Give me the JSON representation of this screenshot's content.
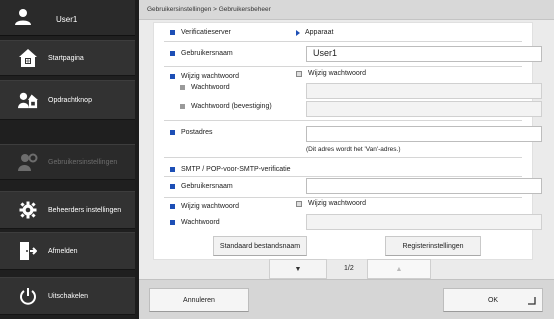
{
  "sidebar": {
    "user_label": "User1",
    "items": [
      {
        "label": "Startpagina"
      },
      {
        "label": "Opdrachtknop"
      },
      {
        "label": "Gebruikersinstellingen"
      },
      {
        "label": "Beheerders instellingen"
      },
      {
        "label": "Afmelden"
      },
      {
        "label": "Uitschakelen"
      }
    ]
  },
  "breadcrumb": "Gebruikersinstellingen > Gebruikersbeheer",
  "form": {
    "verification_server_label": "Verificatieserver",
    "verification_server_value": "Apparaat",
    "username_label": "Gebruikersnaam",
    "username_value": "User1",
    "change_password_label": "Wijzig wachtwoord",
    "change_password_checkbox_label": "Wijzig wachtwoord",
    "password_label": "Wachtwoord",
    "password_confirm_label": "Wachtwoord (bevestiging)",
    "postal_address_label": "Postadres",
    "postal_address_note": "(Dit adres wordt het 'Van'-adres.)",
    "smtp_section_label": "SMTP / POP-voor-SMTP-verificatie",
    "smtp_username_label": "Gebruikersnaam",
    "smtp_change_password_label": "Wijzig wachtwoord",
    "smtp_change_password_checkbox_label": "Wijzig wachtwoord",
    "smtp_password_label": "Wachtwoord"
  },
  "buttons": {
    "default_filename": "Standaard bestandsnaam",
    "register_settings": "Registerinstellingen",
    "page_down": "▼",
    "page_up": "▲",
    "page_indicator": "1/2"
  },
  "footer": {
    "cancel": "Annuleren",
    "ok": "OK"
  },
  "colors": {
    "accent": "#1d4fb6",
    "sidebar_bg": "#1f1f1f"
  }
}
